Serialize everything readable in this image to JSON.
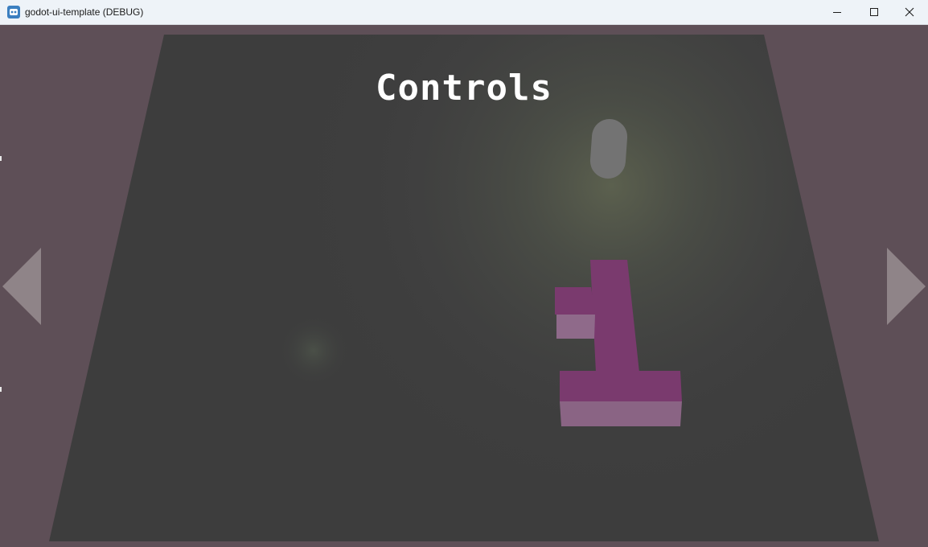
{
  "window": {
    "title": "godot-ui-template (DEBUG)",
    "controls": [
      "minimize-icon",
      "maximize-icon",
      "close-icon"
    ]
  },
  "scene": {
    "heading": "Controls",
    "nav": {
      "left_icon": "triangle-left-icon",
      "right_icon": "triangle-right-icon"
    },
    "colors": {
      "background": "#5e4f57",
      "floor": "#3d3d3d",
      "player_capsule": "#737373",
      "blocks": "#7a3a6e",
      "nav_arrow": "#8f8488"
    }
  }
}
